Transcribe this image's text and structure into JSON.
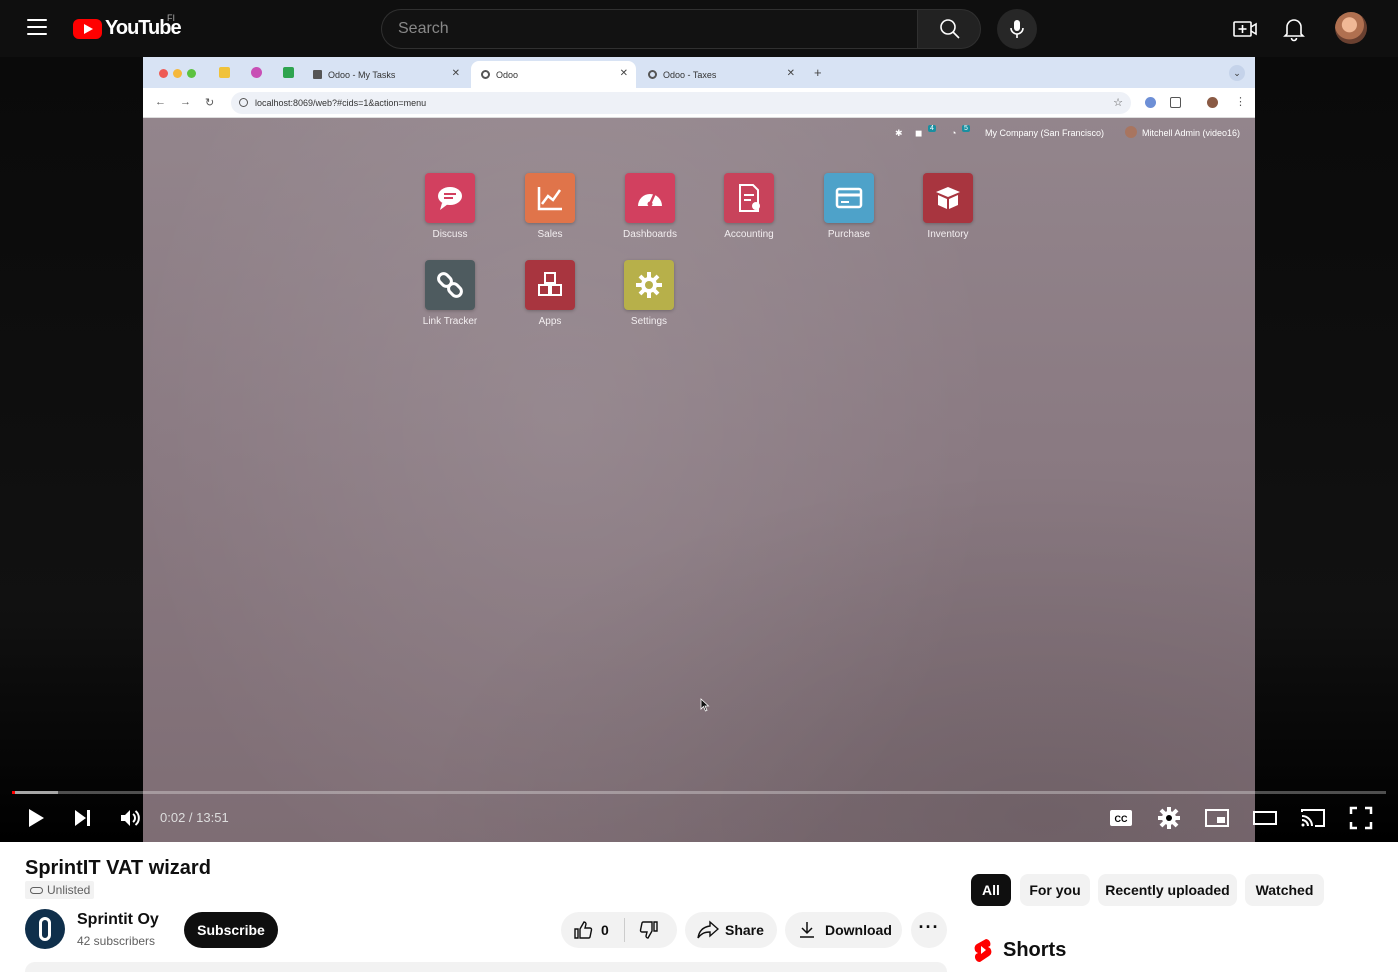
{
  "masthead": {
    "logo_text": "YouTube",
    "region": "FI",
    "search_placeholder": "Search"
  },
  "browser": {
    "tabs": [
      {
        "label": "Odoo - My Tasks",
        "active": false
      },
      {
        "label": "Odoo",
        "active": true
      },
      {
        "label": "Odoo - Taxes",
        "active": false
      }
    ],
    "url": "localhost:8069/web?#cids=1&action=menu"
  },
  "odoo": {
    "topbar": {
      "messages_count": "4",
      "activities_count": "5",
      "company": "My Company (San Francisco)",
      "user": "Mitchell Admin (video16)"
    },
    "apps": [
      {
        "label": "Discuss",
        "icon": "chat-icon",
        "color": "#d2405f"
      },
      {
        "label": "Sales",
        "icon": "chart-icon",
        "color": "#e0744a"
      },
      {
        "label": "Dashboards",
        "icon": "gauge-icon",
        "color": "#d2405f"
      },
      {
        "label": "Accounting",
        "icon": "invoice-icon",
        "color": "#c8435b"
      },
      {
        "label": "Purchase",
        "icon": "card-icon",
        "color": "#4ea2c9"
      },
      {
        "label": "Inventory",
        "icon": "box-icon",
        "color": "#a8353f"
      },
      {
        "label": "Link Tracker",
        "icon": "link-icon",
        "color": "#4e5b5f"
      },
      {
        "label": "Apps",
        "icon": "cubes-icon",
        "color": "#a8353f"
      },
      {
        "label": "Settings",
        "icon": "gear-icon",
        "color": "#b7b04a"
      }
    ]
  },
  "player": {
    "current_time": "0:02",
    "duration": "13:51",
    "time_display": "0:02 / 13:51",
    "progress_fraction": 0.0024
  },
  "video": {
    "title": "SprintIT VAT wizard",
    "visibility": "Unlisted",
    "channel_name": "Sprintit Oy",
    "subscribers": "42 subscribers",
    "subscribe_label": "Subscribe",
    "like_count": "0",
    "share_label": "Share",
    "download_label": "Download"
  },
  "chips": [
    {
      "label": "All",
      "active": true
    },
    {
      "label": "For you",
      "active": false
    },
    {
      "label": "Recently uploaded",
      "active": false
    },
    {
      "label": "Watched",
      "active": false
    }
  ],
  "shorts_label": "Shorts",
  "colors": {
    "accent": "#ff0000",
    "dark": "#0f0f0f"
  }
}
